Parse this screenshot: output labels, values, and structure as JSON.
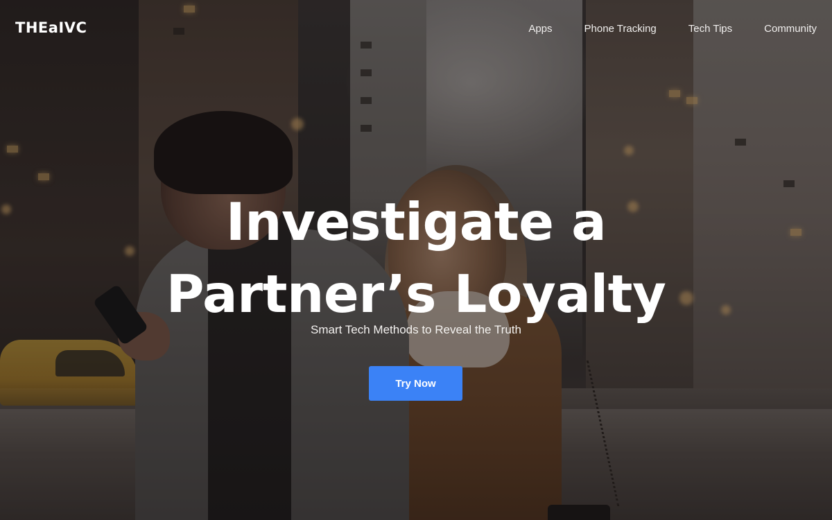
{
  "header": {
    "logo_text": "THEaIVC",
    "nav": [
      {
        "label": "Apps"
      },
      {
        "label": "Phone Tracking"
      },
      {
        "label": "Tech Tips"
      },
      {
        "label": "Community"
      }
    ]
  },
  "hero": {
    "title_line1": "Investigate a",
    "title_line2": "Partner’s Loyalty",
    "subtitle": "Smart Tech Methods to Reveal the Truth",
    "cta_label": "Try Now"
  },
  "colors": {
    "accent": "#3b82f6",
    "text": "#ffffff"
  }
}
